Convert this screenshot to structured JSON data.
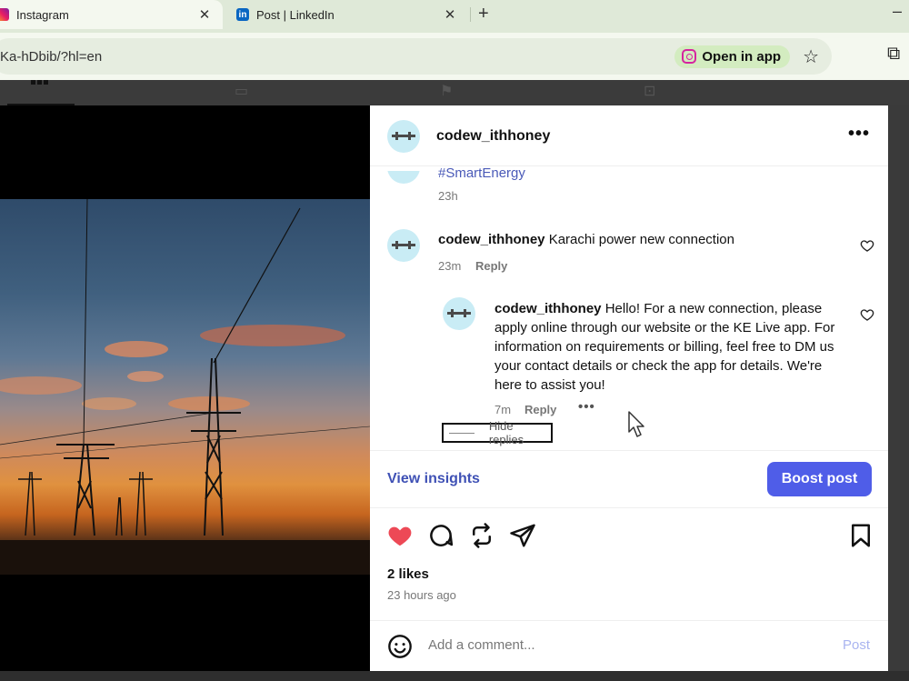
{
  "browser": {
    "tabs": [
      {
        "title": "Instagram",
        "active": true
      },
      {
        "title": "Post | LinkedIn",
        "active": false
      }
    ],
    "new_tab_label": "+",
    "minimize_label": "–",
    "url": "Ka-hDbib/?hl=en",
    "open_in_app_label": "Open in app"
  },
  "post": {
    "username": "codew_ithhoney",
    "hashtag": "#SmartEnergy",
    "caption_time": "23h",
    "comments": [
      {
        "username": "codew_ithhoney",
        "text": "Karachi power new connection",
        "time": "23m",
        "reply_label": "Reply"
      },
      {
        "username": "codew_ithhoney",
        "text": "Hello! For a new connection, please apply online through our website or the KE Live app. For information on requirements or billing, feel free to DM us your contact details or check the app for details. We're here to assist you!",
        "time": "7m",
        "reply_label": "Reply"
      }
    ],
    "hide_replies_label": "Hide replies",
    "view_insights_label": "View insights",
    "boost_post_label": "Boost post",
    "likes": "2 likes",
    "posted_ago": "23 hours ago",
    "comment_placeholder": "Add a comment...",
    "post_label": "Post"
  },
  "colors": {
    "accent": "#4f5de8",
    "link": "#3f51b5",
    "like_red": "#ed4956",
    "hashtag": "#4a5ab8"
  }
}
